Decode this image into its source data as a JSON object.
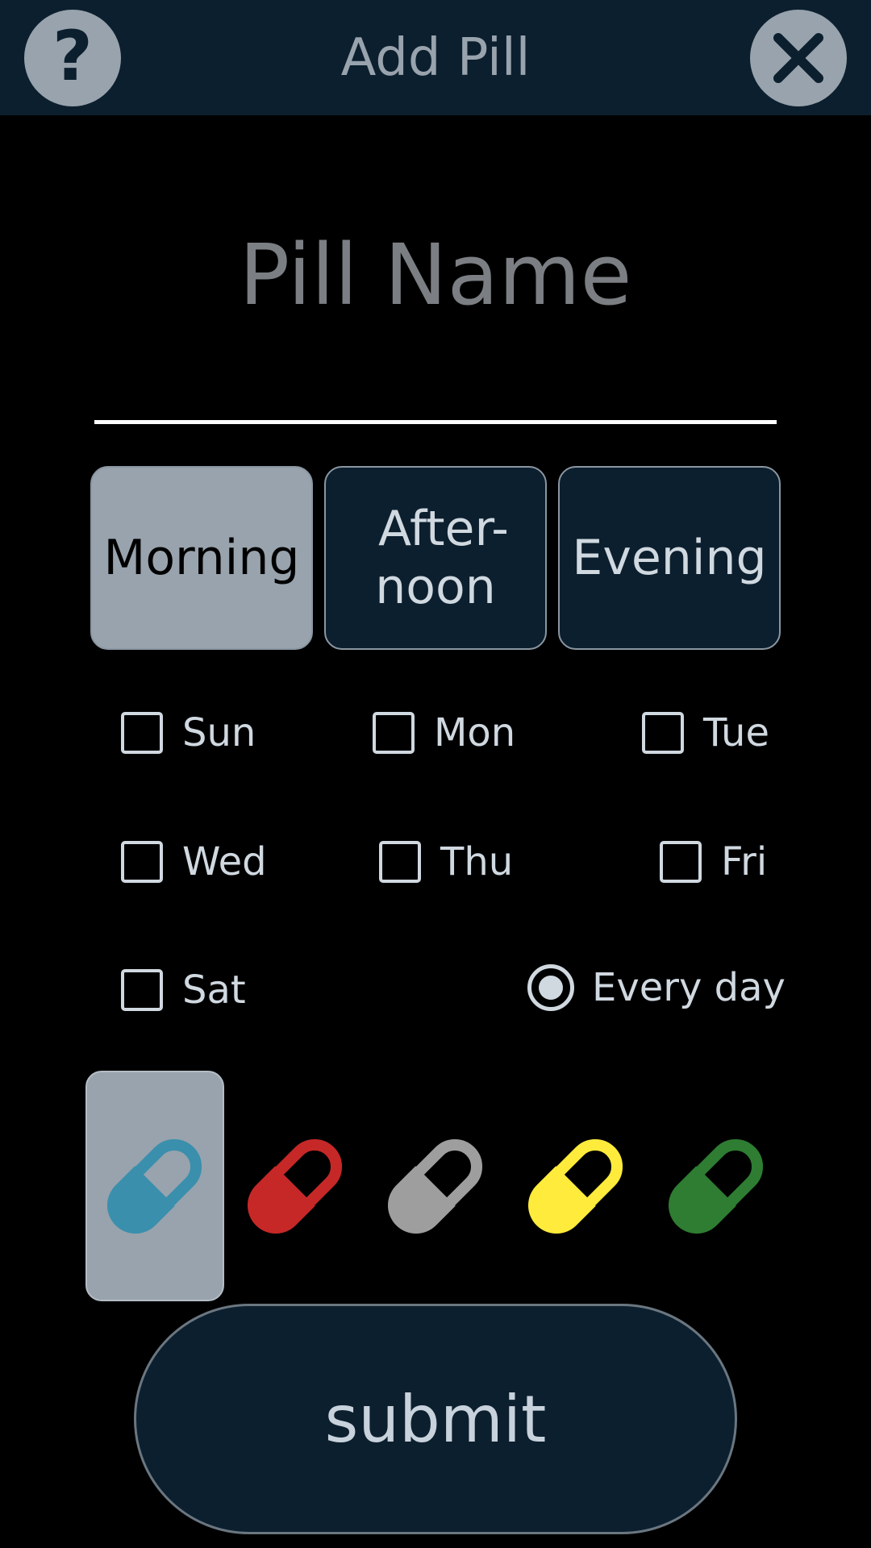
{
  "header": {
    "title": "Add Pill",
    "help_glyph": "?",
    "help_icon": "help-icon",
    "close_icon": "close-icon"
  },
  "pill_name": {
    "value": "",
    "placeholder": "Pill Name"
  },
  "times": {
    "morning": "Morning",
    "afternoon_line1": "After-",
    "afternoon_line2": "noon",
    "evening": "Evening",
    "selected": "Morning"
  },
  "days": {
    "sun": "Sun",
    "mon": "Mon",
    "tue": "Tue",
    "wed": "Wed",
    "thu": "Thu",
    "fri": "Fri",
    "sat": "Sat",
    "every_day": "Every day",
    "every_day_selected": true
  },
  "colors": {
    "blue": "#3a8fad",
    "red": "#c62828",
    "gray": "#9e9e9e",
    "yellow": "#ffeb3b",
    "green": "#2e7d32",
    "selected": "blue",
    "icon": "pill-icon"
  },
  "theme": {
    "background": "#000000",
    "panel": "#0c1f2e",
    "selected": "#98a3ad",
    "text": "#d0d8e0"
  },
  "submit": {
    "label": "submit"
  }
}
